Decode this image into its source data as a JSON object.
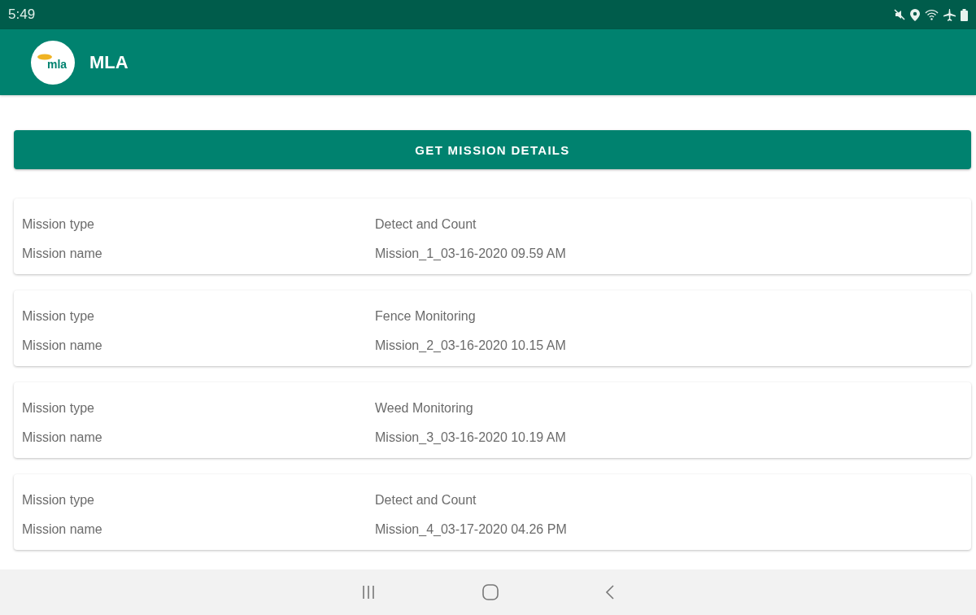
{
  "status_bar": {
    "time": "5:49"
  },
  "app_bar": {
    "logo_text": "mla",
    "title": "MLA"
  },
  "action_button": {
    "label": "GET MISSION DETAILS"
  },
  "missions": [
    {
      "rows": [
        {
          "label": "Mission type",
          "value": "Detect and Count"
        },
        {
          "label": "Mission name",
          "value": "Mission_1_03-16-2020 09.59 AM"
        }
      ]
    },
    {
      "rows": [
        {
          "label": "Mission type",
          "value": "Fence Monitoring"
        },
        {
          "label": "Mission name",
          "value": "Mission_2_03-16-2020 10.15 AM"
        }
      ]
    },
    {
      "rows": [
        {
          "label": "Mission type",
          "value": "Weed Monitoring"
        },
        {
          "label": "Mission name",
          "value": "Mission_3_03-16-2020 10.19 AM"
        }
      ]
    },
    {
      "rows": [
        {
          "label": "Mission type",
          "value": "Detect and Count"
        },
        {
          "label": "Mission name",
          "value": "Mission_4_03-17-2020 04.26 PM"
        }
      ]
    }
  ]
}
